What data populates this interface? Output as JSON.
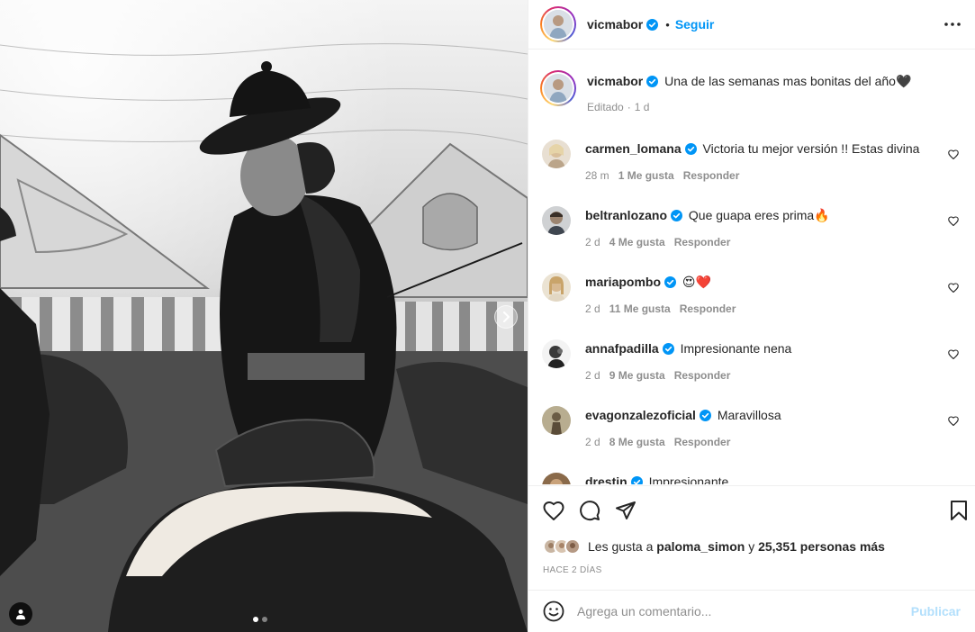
{
  "post": {
    "author": "vicmabor",
    "follow_label": "Seguir",
    "separator": "•",
    "caption_text": "Una de las semanas mas bonitas del año",
    "caption_emoji": "🖤",
    "edited_label": "Editado",
    "edited_dot": "·",
    "edited_time": "1 d"
  },
  "comments": [
    {
      "user": "carmen_lomana",
      "text": "Victoria tu mejor versión !! Estas divina",
      "time": "28 m",
      "likes": "1 Me gusta",
      "reply": "Responder",
      "avatar_color": "#c9b8a4"
    },
    {
      "user": "beltranlozano",
      "text": "Que guapa eres prima",
      "emoji": "🔥",
      "time": "2 d",
      "likes": "4 Me gusta",
      "reply": "Responder",
      "avatar_color": "#6d7277"
    },
    {
      "user": "mariapombo",
      "text": "",
      "emoji": "😍❤️",
      "time": "2 d",
      "likes": "11 Me gusta",
      "reply": "Responder",
      "avatar_color": "#d9c7a8"
    },
    {
      "user": "annafpadilla",
      "text": "Impresionante nena",
      "time": "2 d",
      "likes": "9 Me gusta",
      "reply": "Responder",
      "avatar_color": "#3d3d3d"
    },
    {
      "user": "evagonzalezoficial",
      "text": "Maravillosa",
      "time": "2 d",
      "likes": "8 Me gusta",
      "reply": "Responder",
      "avatar_color": "#a59b7c"
    },
    {
      "user": "drestin",
      "text": "Impresionante",
      "time": "",
      "likes": "",
      "reply": "",
      "avatar_color": "#8a6a4a"
    }
  ],
  "likes": {
    "prefix": "Les gusta a",
    "user": "paloma_simon",
    "connector": "y",
    "count": "25,351 personas más"
  },
  "time_ago": "HACE 2 DÍAS",
  "add_comment": {
    "placeholder": "Agrega un comentario...",
    "post_label": "Publicar"
  },
  "carousel": {
    "slides": 2,
    "active_index": 0
  },
  "colors": {
    "verified": "#0095f6",
    "link": "#0095f6",
    "muted": "#8e8e8e",
    "post_disabled": "#b2dffc"
  },
  "icons": [
    "more-icon",
    "heart-icon",
    "comment-icon",
    "share-icon",
    "bookmark-icon",
    "emoji-icon",
    "tag-user-icon",
    "chevron-right-icon",
    "verified-badge-icon"
  ]
}
